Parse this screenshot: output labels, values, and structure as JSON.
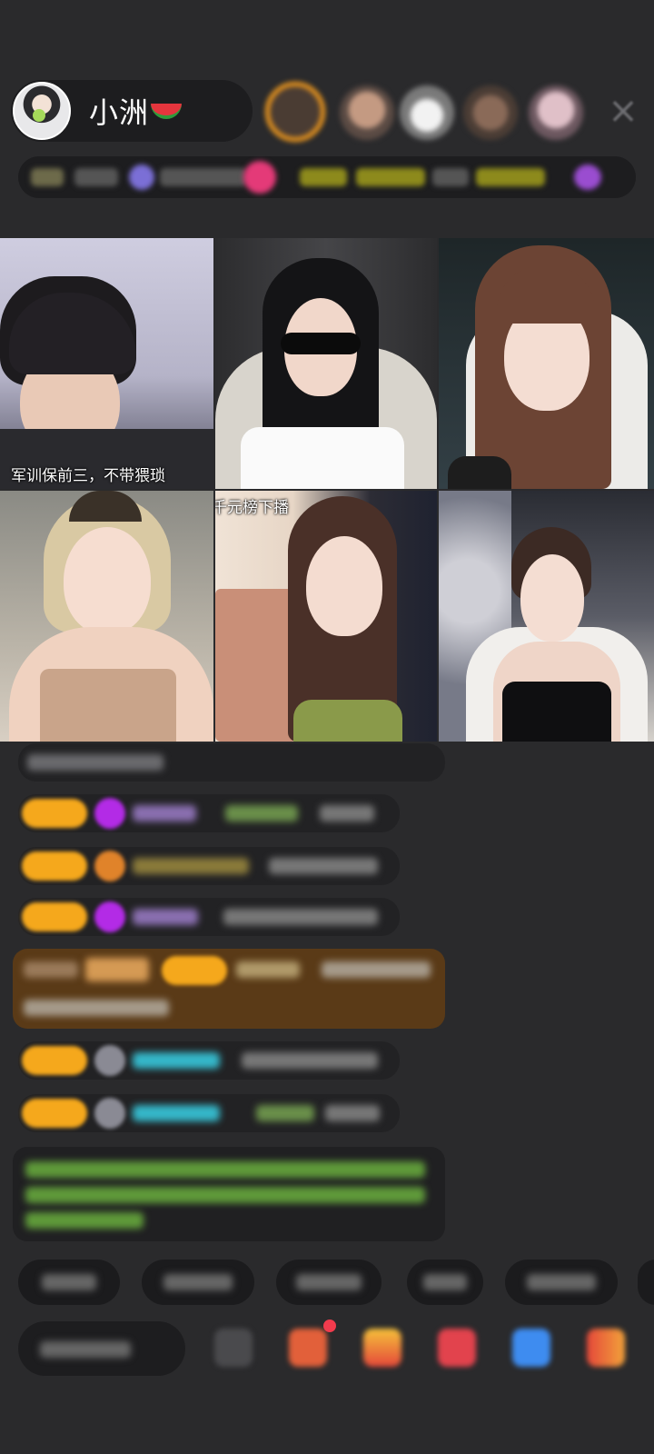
{
  "header": {
    "host_name": "小洲",
    "host_emoji_icon": "watermelon-icon",
    "close_icon": "×"
  },
  "grid": {
    "captions": {
      "tile1": "军训保前三，不带猥琐",
      "tile5": "千元榜下播"
    }
  },
  "colors": {
    "background": "#2a2a2c",
    "badge_orange": "#f5a81c",
    "gem_purple": "#b32be6",
    "highlight_brown": "#5a3a17",
    "green_text": "#7bbf44",
    "cyan_text": "#35b7c9"
  }
}
